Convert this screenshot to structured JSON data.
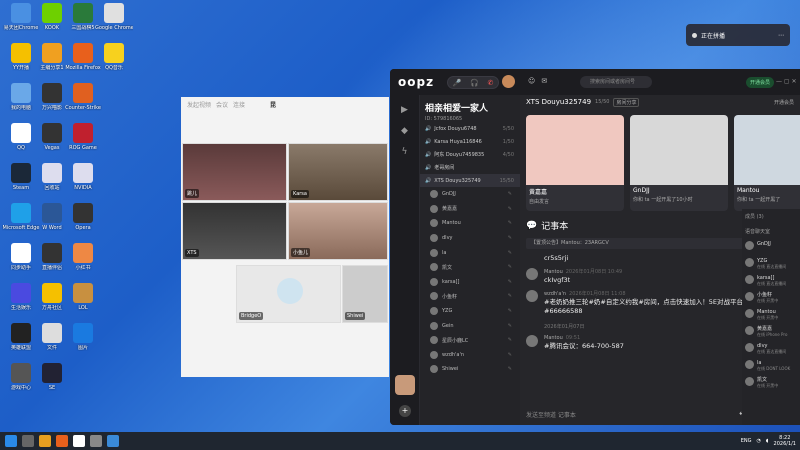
{
  "desktop": {
    "icons": [
      {
        "label": "易天团Chrome",
        "color": "#4a90e2"
      },
      {
        "label": "KOOK",
        "color": "#6ed000"
      },
      {
        "label": "三国战棋5",
        "color": "#2a7a3a"
      },
      {
        "label": "Google Chrome",
        "color": "#e0e0e0"
      },
      {
        "label": "YY开播",
        "color": "#f5c000"
      },
      {
        "label": "主编分享1",
        "color": "#f0a020"
      },
      {
        "label": "Mozilla Firefox",
        "color": "#e8601c"
      },
      {
        "label": "QQ音乐",
        "color": "#f7d11e"
      },
      {
        "label": "我的电脑",
        "color": "#6aa8e8"
      },
      {
        "label": "万兴喵影",
        "color": "#333"
      },
      {
        "label": "Counter-Strike",
        "color": "#e06020"
      },
      {
        "label": "QQ",
        "color": "#ffffff"
      },
      {
        "label": "Vegas",
        "color": "#333"
      },
      {
        "label": "ROG Game",
        "color": "#c0202e"
      },
      {
        "label": "Steam",
        "color": "#1b2838"
      },
      {
        "label": "回收站",
        "color": "#dde"
      },
      {
        "label": "NVIDIA",
        "color": "#dde"
      },
      {
        "label": "Microsoft Edge",
        "color": "#1fa0e8"
      },
      {
        "label": "W Word",
        "color": "#2b5797"
      },
      {
        "label": "Opera",
        "color": "#333"
      },
      {
        "label": "同步助手",
        "color": "#ffffff"
      },
      {
        "label": "直播伴侣",
        "color": "#333"
      },
      {
        "label": "小红书",
        "color": "#e84"
      },
      {
        "label": "生活娱乐",
        "color": "#4a4ae0"
      },
      {
        "label": "方舟社区",
        "color": "#f5c000"
      },
      {
        "label": "LOL",
        "color": "#c89040"
      },
      {
        "label": "英雄联盟",
        "color": "#222"
      },
      {
        "label": "文件",
        "color": "#ddd"
      },
      {
        "label": "图片",
        "color": "#1a7ae0"
      },
      {
        "label": "游戏中心",
        "color": "#555"
      },
      {
        "label": "SE",
        "color": "#223"
      }
    ]
  },
  "notification": {
    "text": "正在拼播"
  },
  "video_window": {
    "title": "昆",
    "tabs": [
      "发起视频",
      "会议",
      "连接"
    ],
    "participants": [
      {
        "name": "跳儿",
        "bg": "#6b4a4a"
      },
      {
        "name": "Karsa",
        "bg": "#7a6a5a"
      },
      {
        "name": "XTS",
        "bg": "#444"
      },
      {
        "name": "小鱼儿",
        "bg": "#b89a8a"
      },
      {
        "name": "BridgeO",
        "bg": "#e8e8e8"
      },
      {
        "name": "Shiwei",
        "bg": "#ddd"
      }
    ]
  },
  "app": {
    "logo": "oopz",
    "search_placeholder": "搜索房间或者房间号",
    "vip": "开通会员",
    "channel": {
      "title": "相亲相爱一家人",
      "id": "ID: 579816065"
    },
    "channels": [
      {
        "name": "Jcfox Douyu6748",
        "count": "5/50"
      },
      {
        "name": "Karsa Huya116846",
        "count": "1/50"
      },
      {
        "name": "阿东 Douyu7459835",
        "count": "4/50"
      },
      {
        "name": "老哥房间",
        "count": ""
      },
      {
        "name": "XTS Douyu325749",
        "count": "15/50"
      }
    ],
    "members": [
      "GnDJJ",
      "黄嘉嘉",
      "Mantou",
      "dlvy",
      "la",
      "凯文",
      "karsa[]",
      "小鱼籽",
      "YZG",
      "Gein",
      "星辰小鹿LC",
      "wzdh'a'n",
      "Shiwei"
    ],
    "room": {
      "name": "XTS Douyu325749",
      "count": "15/50",
      "tag": "房间分享",
      "right": "开通会员"
    },
    "cards": [
      {
        "name": "黄嘉嘉",
        "status": "自由发言",
        "bg": "#f0c8c0"
      },
      {
        "name": "GnDJJ",
        "status": "你和 ta 一起开黑了10小时",
        "bg": "#d8d8d8"
      },
      {
        "name": "Mantou",
        "status": "你和 ta 一起开黑了",
        "bg": "#cfd8e0"
      }
    ],
    "notes": {
      "title": "记事本",
      "pin": "【置顶公告】Mantou：23ARGCV",
      "messages": [
        {
          "name": "",
          "time": "",
          "text": "cr5s5rji"
        },
        {
          "name": "Mantou",
          "time": "2026年01月08日 10:49",
          "text": "ckIvgf3t"
        },
        {
          "name": "wzdh'a'n",
          "time": "2026年01月08日 11:08",
          "text": "#老奶奶推三轮#奶#自定义约我#房间，点击快速加入！5E对战平台房间号：#66666588"
        },
        {
          "name": "Mantou",
          "time": "09:51",
          "text": "#腾讯会议：664-700-587"
        }
      ],
      "date_divider": "2026年01月07日"
    },
    "input_placeholder": "发送至频道 记事本",
    "right_header": "成员 (3)",
    "right_sub": "语音聊天室",
    "right_members": [
      {
        "name": "GnDJJ",
        "sub": ""
      },
      {
        "name": "YZG",
        "sub": "在线  直达直播间"
      },
      {
        "name": "karsa[]",
        "sub": "在线  直达直播间"
      },
      {
        "name": "小鱼籽",
        "sub": "在线  开黑中"
      },
      {
        "name": "Mantou",
        "sub": "在线  开黑中"
      },
      {
        "name": "黄嘉嘉",
        "sub": "在线  iPhone Pro"
      },
      {
        "name": "dlvy",
        "sub": "在线  直达直播间"
      },
      {
        "name": "la",
        "sub": "在线  DONT LOOK"
      },
      {
        "name": "凯文",
        "sub": "在线  开黑中"
      }
    ]
  },
  "taskbar": {
    "time": "8:22",
    "date": "2026/1/1",
    "lang": "ENG"
  }
}
